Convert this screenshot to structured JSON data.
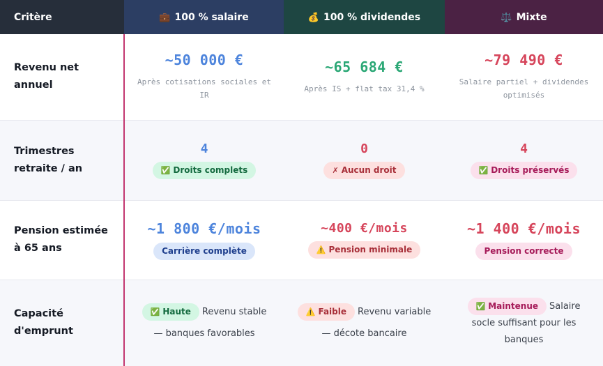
{
  "header": {
    "criteria": "Critère",
    "salary": {
      "icon": "💼",
      "label": "100 % salaire"
    },
    "dividends": {
      "icon": "💰",
      "label": "100 % dividendes"
    },
    "mixed": {
      "icon": "⚖️",
      "label": "Mixte"
    }
  },
  "rows": {
    "income": {
      "label": "Revenu net annuel",
      "salary": {
        "value": "~50 000 €",
        "note": "Après cotisations sociales et IR"
      },
      "dividends": {
        "value": "~65 684 €",
        "note": "Après IS + flat tax 31,4 %"
      },
      "mixed": {
        "value": "~79 490 €",
        "note": "Salaire partiel + dividendes optimisés"
      }
    },
    "quarters": {
      "label": "Trimestres retraite / an",
      "salary": {
        "value": "4",
        "badge_icon": "✅",
        "badge": "Droits complets"
      },
      "dividends": {
        "value": "0",
        "badge_icon": "✗",
        "badge": "Aucun droit"
      },
      "mixed": {
        "value": "4",
        "badge_icon": "✅",
        "badge": "Droits préservés"
      }
    },
    "pension": {
      "label": "Pension estimée à 65 ans",
      "salary": {
        "value": "~1 800 €/mois",
        "badge": "Carrière complète"
      },
      "dividends": {
        "value": "~400 €/mois",
        "badge_icon": "⚠️",
        "badge": "Pension minimale"
      },
      "mixed": {
        "value": "~1 400 €/mois",
        "badge": "Pension correcte"
      }
    },
    "borrowing": {
      "label": "Capacité d'emprunt",
      "salary": {
        "badge_icon": "✅",
        "badge": "Haute",
        "text1": "Revenu stable",
        "text2": "— banques favorables"
      },
      "dividends": {
        "badge_icon": "⚠️",
        "badge": "Faible",
        "text1": "Revenu variable",
        "text2": "— décote bancaire"
      },
      "mixed": {
        "badge_icon": "✅",
        "badge": "Maintenue",
        "text1": "Salaire",
        "text2": "socle suffisant pour les",
        "text3": "banques"
      }
    }
  },
  "colors": {
    "header_criteria": "#262e3a",
    "header_salary": "#2c3e63",
    "header_dividends": "#1e4642",
    "header_mixed": "#4b2244",
    "accent_divider": "#c2366f",
    "value_blue": "#4d84dc",
    "value_green": "#2aa775",
    "value_red": "#d6455b"
  }
}
